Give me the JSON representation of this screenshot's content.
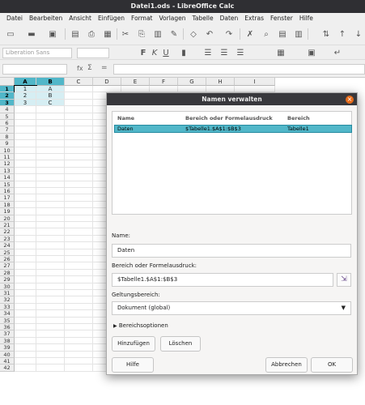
{
  "window": {
    "title": "Datei1.ods - LibreOffice Calc"
  },
  "menu": [
    "Datei",
    "Bearbeiten",
    "Ansicht",
    "Einfügen",
    "Format",
    "Vorlagen",
    "Tabelle",
    "Daten",
    "Extras",
    "Fenster",
    "Hilfe"
  ],
  "formatting": {
    "font_name": "Liberation Sans",
    "bold": "F",
    "italic": "K",
    "underline": "U"
  },
  "formula_bar": {
    "fx": "fx",
    "sum": "Σ",
    "equal": "="
  },
  "columns": [
    "A",
    "B",
    "C",
    "D",
    "E",
    "F",
    "G",
    "H",
    "I"
  ],
  "rows": [
    "1",
    "2",
    "3",
    "4",
    "5",
    "6",
    "7",
    "8",
    "9",
    "10",
    "11",
    "12",
    "13",
    "14",
    "15",
    "16",
    "17",
    "18",
    "19",
    "20",
    "21",
    "22",
    "23",
    "24",
    "25",
    "26",
    "27",
    "28",
    "29",
    "30",
    "31",
    "32",
    "33",
    "34",
    "35",
    "36",
    "37",
    "38",
    "39",
    "40",
    "41",
    "42"
  ],
  "cells": {
    "A1": "1",
    "A2": "2",
    "A3": "3",
    "B1": "A",
    "B2": "B",
    "B3": "C"
  },
  "dialog": {
    "title": "Namen verwalten",
    "close": "×",
    "headers": {
      "name": "Name",
      "range": "Bereich oder Formelausdruck",
      "scope": "Bereich"
    },
    "row": {
      "name": "Daten",
      "range": "$Tabelle1.$A$1:$B$3",
      "scope": "Tabelle1"
    },
    "name_label": "Name:",
    "name_value": "Daten",
    "range_label": "Bereich oder Formelausdruck:",
    "range_value": "$Tabelle1.$A$1:$B$3",
    "scope_label": "Geltungsbereich:",
    "scope_value": "Dokument (global)",
    "options_label": "Bereichsoptionen",
    "add_button": "Hinzufügen",
    "delete_button": "Löschen",
    "help_button": "Hilfe",
    "cancel_button": "Abbrechen",
    "ok_button": "OK"
  },
  "colors": {
    "accent": "#51b7c9",
    "close": "#e66b1a"
  }
}
